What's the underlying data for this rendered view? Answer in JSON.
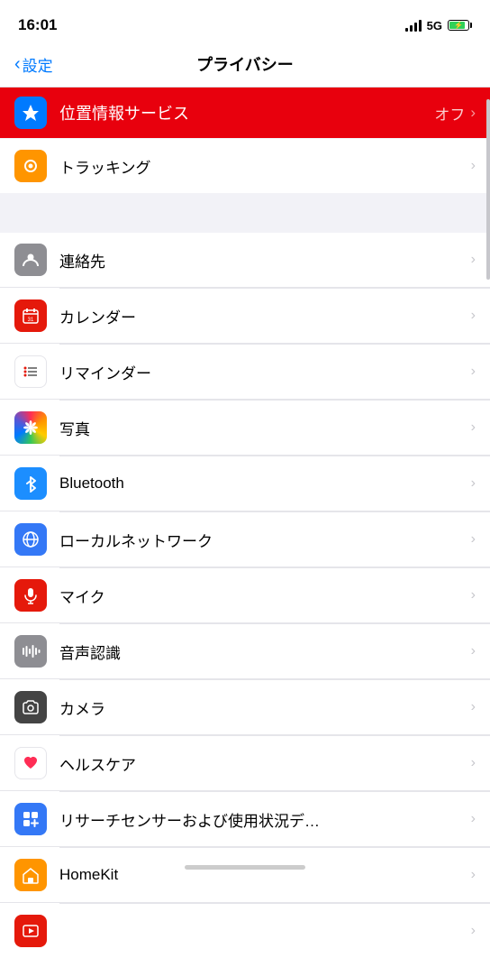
{
  "statusBar": {
    "time": "16:01",
    "network": "5G"
  },
  "nav": {
    "backLabel": "設定",
    "title": "プライバシー"
  },
  "rows": [
    {
      "id": "location",
      "label": "位置情報サービス",
      "value": "オフ",
      "iconBg": "#007aff",
      "iconSymbol": "arrow",
      "highlighted": true
    },
    {
      "id": "tracking",
      "label": "トラッキング",
      "value": "",
      "iconBg": "#ff9500",
      "iconSymbol": "hand"
    },
    {
      "id": "contacts",
      "label": "連絡先",
      "value": "",
      "iconBg": "#8e8e93",
      "iconSymbol": "person"
    },
    {
      "id": "calendar",
      "label": "カレンダー",
      "value": "",
      "iconBg": "#e5190b",
      "iconSymbol": "calendar"
    },
    {
      "id": "reminders",
      "label": "リマインダー",
      "value": "",
      "iconBg": "#ffffff",
      "iconSymbol": "list"
    },
    {
      "id": "photos",
      "label": "写真",
      "value": "",
      "iconBg": "photos",
      "iconSymbol": "photos"
    },
    {
      "id": "bluetooth",
      "label": "Bluetooth",
      "value": "",
      "iconBg": "#1c8eff",
      "iconSymbol": "bluetooth"
    },
    {
      "id": "localnet",
      "label": "ローカルネットワーク",
      "value": "",
      "iconBg": "#3478f6",
      "iconSymbol": "globe"
    },
    {
      "id": "microphone",
      "label": "マイク",
      "value": "",
      "iconBg": "#e5190b",
      "iconSymbol": "mic"
    },
    {
      "id": "speech",
      "label": "音声認識",
      "value": "",
      "iconBg": "#8e8e93",
      "iconSymbol": "wave"
    },
    {
      "id": "camera",
      "label": "カメラ",
      "value": "",
      "iconBg": "#444444",
      "iconSymbol": "camera"
    },
    {
      "id": "health",
      "label": "ヘルスケア",
      "value": "",
      "iconBg": "#ffffff",
      "iconSymbol": "heart"
    },
    {
      "id": "research",
      "label": "リサーチセンサーおよび使用状況デ…",
      "value": "",
      "iconBg": "#3478f6",
      "iconSymbol": "research"
    },
    {
      "id": "homekit",
      "label": "HomeKit",
      "value": "",
      "iconBg": "#ff9500",
      "iconSymbol": "home"
    },
    {
      "id": "media",
      "label": "",
      "value": "",
      "iconBg": "#e5190b",
      "iconSymbol": "media"
    }
  ]
}
